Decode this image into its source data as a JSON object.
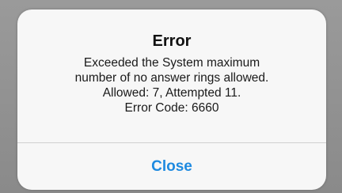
{
  "alert": {
    "title": "Error",
    "message_lines": [
      "Exceeded the System maximum",
      "number of no answer rings allowed.",
      "Allowed: 7, Attempted 11.",
      "Error Code: 6660"
    ],
    "close_label": "Close"
  },
  "colors": {
    "accent": "#1e8ae0",
    "dialog_background": "#f7f7f7",
    "backdrop": "#8f8f8f"
  }
}
